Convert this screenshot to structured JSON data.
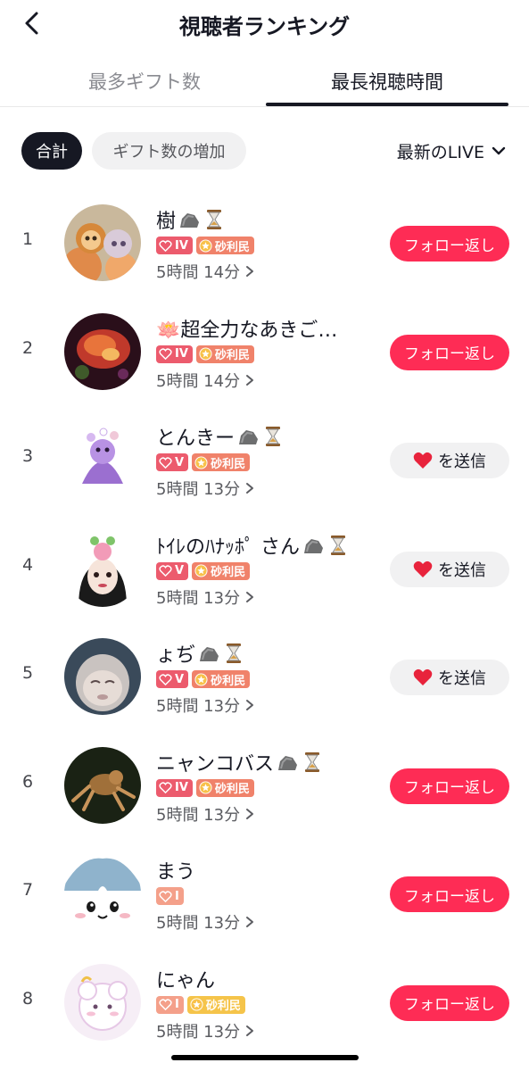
{
  "header": {
    "title": "視聴者ランキング",
    "back_icon": "chevron-left-icon"
  },
  "tabs": [
    {
      "label": "最多ギフト数",
      "active": false
    },
    {
      "label": "最長視聴時間",
      "active": true
    }
  ],
  "filters": {
    "chips": [
      {
        "label": "合計",
        "active": true
      },
      {
        "label": "ギフト数の増加",
        "active": false
      }
    ],
    "live_select": "最新のLIVE"
  },
  "colors": {
    "follow": "#fe2c55",
    "text": "#161823",
    "muted": "#8a8b91"
  },
  "viewers": [
    {
      "rank": "1",
      "name": "樹",
      "level": "IV",
      "fan_badge": "砂利民",
      "duration": "5時間 14分",
      "action": "フォロー返し",
      "action_type": "follow"
    },
    {
      "rank": "2",
      "name": "🪷超全力なあきご…",
      "level": "IV",
      "fan_badge": "砂利民",
      "duration": "5時間 14分",
      "action": "フォロー返し",
      "action_type": "follow"
    },
    {
      "rank": "3",
      "name": "とんきー",
      "level": "V",
      "fan_badge": "砂利民",
      "duration": "5時間 13分",
      "action": "を送信",
      "action_type": "gift"
    },
    {
      "rank": "4",
      "name": "ﾄｲﾚのﾊﾅｯﾎﾟ さん",
      "level": "V",
      "fan_badge": "砂利民",
      "duration": "5時間 13分",
      "action": "を送信",
      "action_type": "gift"
    },
    {
      "rank": "5",
      "name": "ょぢ",
      "level": "V",
      "fan_badge": "砂利民",
      "duration": "5時間 13分",
      "action": "を送信",
      "action_type": "gift"
    },
    {
      "rank": "6",
      "name": "ニャンコバス",
      "level": "IV",
      "fan_badge": "砂利民",
      "duration": "5時間 13分",
      "action": "フォロー返し",
      "action_type": "follow"
    },
    {
      "rank": "7",
      "name": "まう",
      "level": "I",
      "fan_badge": "",
      "duration": "5時間 13分",
      "action": "フォロー返し",
      "action_type": "follow"
    },
    {
      "rank": "8",
      "name": "にゃん",
      "level": "I",
      "fan_badge": "砂利民",
      "duration": "5時間 13分",
      "action": "フォロー返し",
      "action_type": "follow"
    }
  ]
}
